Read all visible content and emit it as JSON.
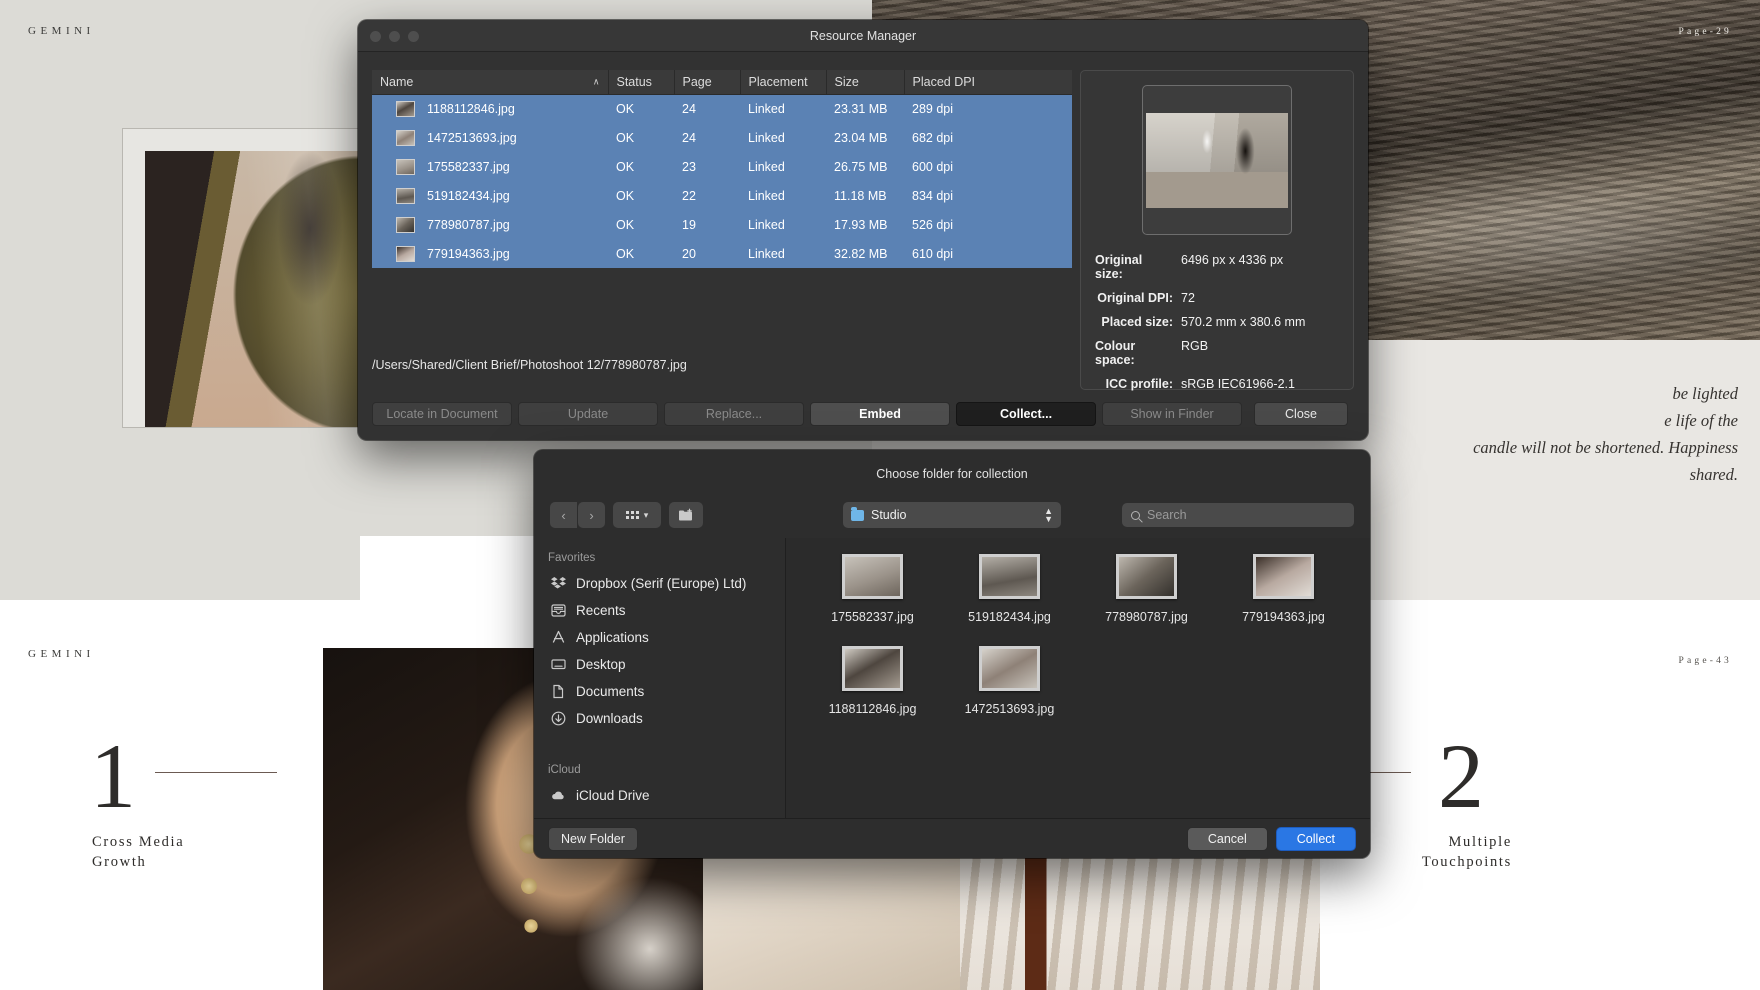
{
  "document": {
    "brand": "GEMINI",
    "page_top_right": "Page-29",
    "page_bottom_right": "Page-43",
    "quote_line1": "be lighted",
    "quote_line2": "e life of the",
    "quote_line3": "candle will not be shortened. Happiness",
    "quote_line4": "shared.",
    "section_one_number": "1",
    "section_one_caption_line1": "Cross Media",
    "section_one_caption_line2": "Growth",
    "section_two_number": "2",
    "section_two_caption_line1": "Multiple",
    "section_two_caption_line2": "Touchpoints"
  },
  "resource_manager": {
    "title": "Resource Manager",
    "columns": {
      "name": "Name",
      "status": "Status",
      "page": "Page",
      "placement": "Placement",
      "size": "Size",
      "placed_dpi": "Placed DPI"
    },
    "sort_indicator": "∧",
    "rows": [
      {
        "name": "1188112846.jpg",
        "status": "OK",
        "page": "24",
        "placement": "Linked",
        "size": "23.31 MB",
        "dpi": "289 dpi"
      },
      {
        "name": "1472513693.jpg",
        "status": "OK",
        "page": "24",
        "placement": "Linked",
        "size": "23.04 MB",
        "dpi": "682 dpi"
      },
      {
        "name": "175582337.jpg",
        "status": "OK",
        "page": "23",
        "placement": "Linked",
        "size": "26.75 MB",
        "dpi": "600 dpi"
      },
      {
        "name": "519182434.jpg",
        "status": "OK",
        "page": "22",
        "placement": "Linked",
        "size": "11.18 MB",
        "dpi": "834 dpi"
      },
      {
        "name": "778980787.jpg",
        "status": "OK",
        "page": "19",
        "placement": "Linked",
        "size": "17.93 MB",
        "dpi": "526 dpi"
      },
      {
        "name": "779194363.jpg",
        "status": "OK",
        "page": "20",
        "placement": "Linked",
        "size": "32.82 MB",
        "dpi": "610 dpi"
      }
    ],
    "path": "/Users/Shared/Client Brief/Photoshoot 12/778980787.jpg",
    "buttons": {
      "locate": "Locate in Document",
      "update": "Update",
      "replace": "Replace...",
      "embed": "Embed",
      "collect": "Collect...",
      "show_in_finder": "Show in Finder",
      "close": "Close"
    },
    "preview_meta": [
      {
        "key": "Original size:",
        "value": "6496 px x 4336 px"
      },
      {
        "key": "Original DPI:",
        "value": "72"
      },
      {
        "key": "Placed size:",
        "value": "570.2 mm x 380.6 mm"
      },
      {
        "key": "Colour space:",
        "value": "RGB"
      },
      {
        "key": "ICC profile:",
        "value": "sRGB IEC61966-2.1"
      }
    ]
  },
  "folder_chooser": {
    "title": "Choose folder for collection",
    "location": "Studio",
    "search_placeholder": "Search",
    "sidebar": {
      "favorites_label": "Favorites",
      "favorites": [
        {
          "label": "Dropbox (Serif (Europe) Ltd)",
          "icon": "dropbox-icon"
        },
        {
          "label": "Recents",
          "icon": "recents-icon"
        },
        {
          "label": "Applications",
          "icon": "applications-icon"
        },
        {
          "label": "Desktop",
          "icon": "desktop-icon"
        },
        {
          "label": "Documents",
          "icon": "documents-icon"
        },
        {
          "label": "Downloads",
          "icon": "downloads-icon"
        }
      ],
      "icloud_label": "iCloud",
      "icloud": [
        {
          "label": "iCloud Drive",
          "icon": "icloud-drive-icon"
        }
      ]
    },
    "files": [
      {
        "name": "175582337.jpg"
      },
      {
        "name": "519182434.jpg"
      },
      {
        "name": "778980787.jpg"
      },
      {
        "name": "779194363.jpg"
      },
      {
        "name": "1188112846.jpg"
      },
      {
        "name": "1472513693.jpg"
      }
    ],
    "buttons": {
      "new_folder": "New Folder",
      "cancel": "Cancel",
      "collect": "Collect"
    }
  },
  "colors": {
    "selection_blue": "#5b82b4",
    "accent_blue": "#2a77e4",
    "window_bg": "#323232"
  }
}
